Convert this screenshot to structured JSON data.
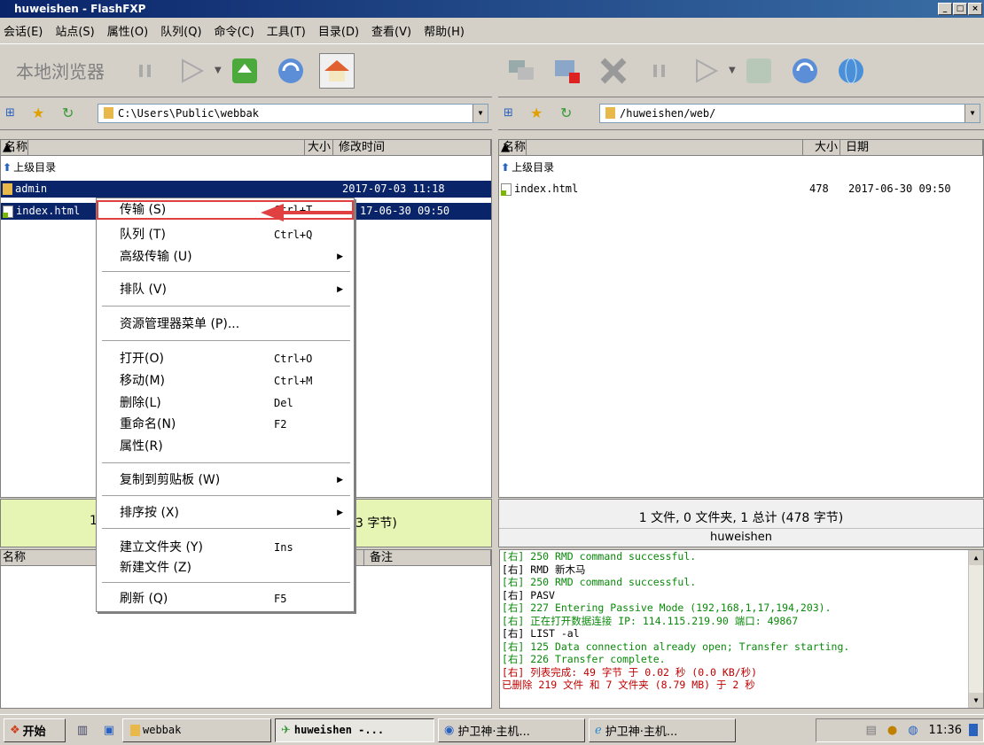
{
  "window": {
    "title": "huweishen - FlashFXP"
  },
  "menu": [
    "会话(E)",
    "站点(S)",
    "属性(O)",
    "队列(Q)",
    "命令(C)",
    "工具(T)",
    "目录(D)",
    "查看(V)",
    "帮助(H)"
  ],
  "left": {
    "toolbar_label": "本地浏览器",
    "path": "C:\\Users\\Public\\webbak",
    "columns": {
      "name": "名称",
      "size": "大小",
      "modified": "修改时间"
    },
    "up": "上级目录",
    "rows": [
      {
        "name": "admin",
        "date": "2017-07-03 11:18"
      },
      {
        "name": "index.html",
        "date": "17-06-30 09:50"
      }
    ],
    "status_prefix": "1",
    "status_suffix": "3 字节)",
    "queue_cols": {
      "name": "名称",
      "note": "备注"
    }
  },
  "right": {
    "path": "/huweishen/web/",
    "columns": {
      "name": "名称",
      "size": "大小",
      "date": "日期"
    },
    "up": "上级目录",
    "rows": [
      {
        "name": "index.html",
        "size": "478",
        "date": "2017-06-30 09:50"
      }
    ],
    "status": "1 文件, 0 文件夹, 1 总计 (478 字节)",
    "user": "huweishen"
  },
  "context_menu": [
    {
      "label": "传输 (S)",
      "shortcut": "Ctrl+T"
    },
    {
      "label": "队列 (T)",
      "shortcut": "Ctrl+Q"
    },
    {
      "label": "高级传输 (U)"
    },
    {
      "label": "排队 (V)"
    },
    {
      "label": "资源管理器菜单 (P)..."
    },
    {
      "label": "打开(O)",
      "shortcut": "Ctrl+O"
    },
    {
      "label": "移动(M)",
      "shortcut": "Ctrl+M"
    },
    {
      "label": "删除(L)",
      "shortcut": "Del"
    },
    {
      "label": "重命名(N)",
      "shortcut": "F2"
    },
    {
      "label": "属性(R)"
    },
    {
      "label": "复制到剪贴板 (W)"
    },
    {
      "label": "排序按 (X)"
    },
    {
      "label": "建立文件夹 (Y)",
      "shortcut": "Ins"
    },
    {
      "label": "新建文件 (Z)"
    },
    {
      "label": "刷新 (Q)",
      "shortcut": "F5"
    }
  ],
  "log": [
    {
      "t": "[右] 250 RMD command successful.",
      "c": "green"
    },
    {
      "t": "[右] RMD 新木马",
      "c": "black"
    },
    {
      "t": "[右] 250 RMD command successful.",
      "c": "green"
    },
    {
      "t": "[右] PASV",
      "c": "black"
    },
    {
      "t": "[右] 227 Entering Passive Mode (192,168,1,17,194,203).",
      "c": "green"
    },
    {
      "t": "[右] 正在打开数据连接 IP: 114.115.219.90 端口: 49867",
      "c": "green"
    },
    {
      "t": "[右] LIST -al",
      "c": "black"
    },
    {
      "t": "[右] 125 Data connection already open; Transfer starting.",
      "c": "green"
    },
    {
      "t": "[右] 226 Transfer complete.",
      "c": "green"
    },
    {
      "t": "[右] 列表完成: 49 字节 于 0.02 秒 (0.0 KB/秒)",
      "c": "red"
    },
    {
      "t": "已删除 219 文件 和 7 文件夹 (8.79 MB) 于 2 秒",
      "c": "red"
    }
  ],
  "taskbar": {
    "start": "开始",
    "items": [
      "webbak",
      "huweishen -...",
      "护卫神·主机...",
      "护卫神·主机..."
    ],
    "clock": "11:36"
  },
  "colors": {
    "accent": "#0a246a",
    "highlight": "#e04040",
    "status_bg": "#e6f5b4"
  }
}
